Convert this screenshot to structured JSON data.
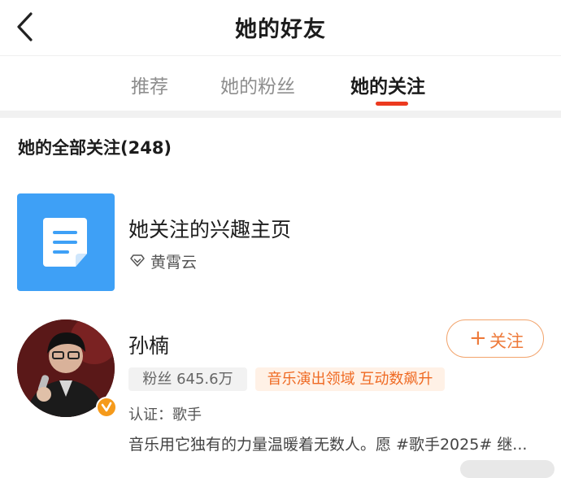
{
  "header": {
    "title": "她的好友"
  },
  "tabs": [
    {
      "label": "推荐",
      "active": false
    },
    {
      "label": "她的粉丝",
      "active": false
    },
    {
      "label": "她的关注",
      "active": true
    }
  ],
  "section": {
    "title": "她的全部关注(248)"
  },
  "interest": {
    "title": "她关注的兴趣主页",
    "owner": "黄霄云",
    "icon": "document-icon"
  },
  "user": {
    "name": "孙楠",
    "follow_label": "关注",
    "fans": "粉丝 645.6万",
    "tag": "音乐演出领域 互动数飙升",
    "verification": "认证：歌手",
    "description": "音乐用它独有的力量温暖着无数人。愿 #歌手2025# 继..."
  },
  "colors": {
    "accent": "#ec3a1f",
    "follow": "#ee7a3a",
    "interest_card": "#3ea0f6",
    "verified_badge": "#f59a1b"
  }
}
